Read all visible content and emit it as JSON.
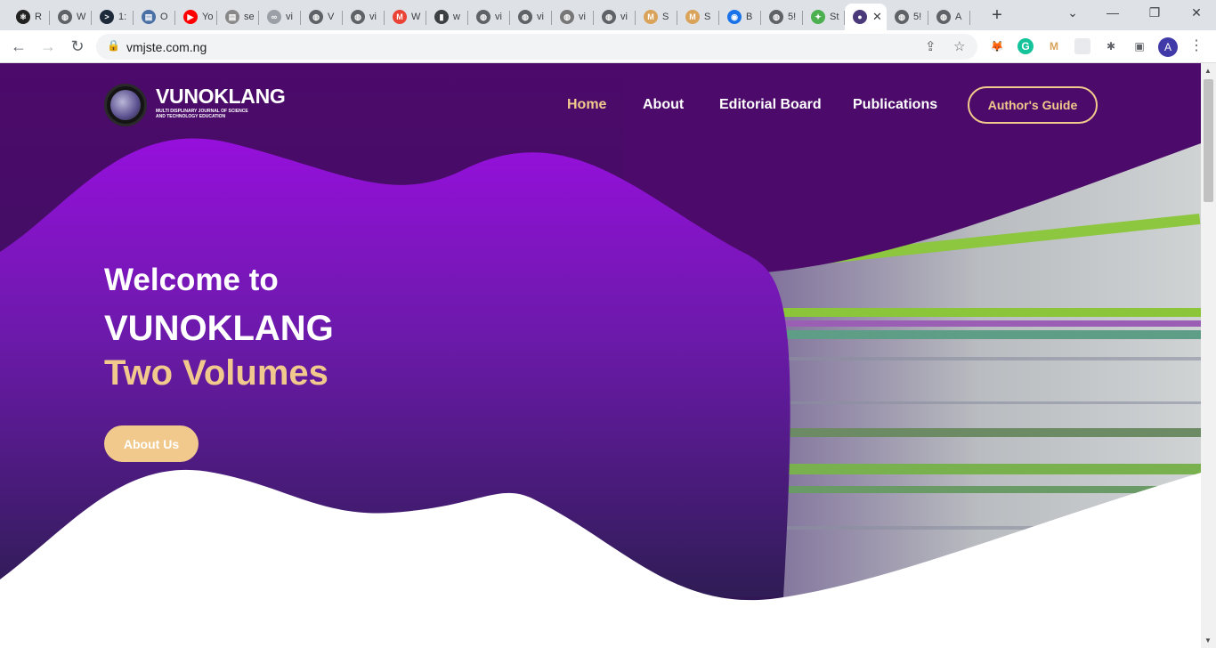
{
  "browser": {
    "tabs": [
      {
        "label": "R",
        "icon": "react-icon",
        "color": "#222"
      },
      {
        "label": "W",
        "icon": "globe-icon",
        "color": "#5f6368"
      },
      {
        "label": "1:",
        "icon": "terminal-icon",
        "color": "#1e2a3a"
      },
      {
        "label": "O",
        "icon": "doc-icon",
        "color": "#4a6fa5"
      },
      {
        "label": "Yo",
        "icon": "youtube-icon",
        "color": "#ff0000"
      },
      {
        "label": "se",
        "icon": "doc-icon",
        "color": "#888"
      },
      {
        "label": "vi",
        "icon": "link-icon",
        "color": "#9aa0a6"
      },
      {
        "label": "V",
        "icon": "globe-icon",
        "color": "#5f6368"
      },
      {
        "label": "vi",
        "icon": "globe-icon",
        "color": "#5f6368"
      },
      {
        "label": "W",
        "icon": "gmail-icon",
        "color": "#ea4335"
      },
      {
        "label": "w",
        "icon": "bookmark-icon",
        "color": "#3c4043"
      },
      {
        "label": "vi",
        "icon": "globe-icon",
        "color": "#5f6368"
      },
      {
        "label": "vi",
        "icon": "globe-icon",
        "color": "#5f6368"
      },
      {
        "label": "vi",
        "icon": "globe-icon",
        "color": "#777"
      },
      {
        "label": "vi",
        "icon": "globe-icon",
        "color": "#5f6368"
      },
      {
        "label": "S",
        "icon": "mail-icon",
        "color": "#d9a35a"
      },
      {
        "label": "S",
        "icon": "mail-icon",
        "color": "#d9a35a"
      },
      {
        "label": "B",
        "icon": "eye-icon",
        "color": "#1a73e8"
      },
      {
        "label": "5!",
        "icon": "globe-icon",
        "color": "#5f6368"
      },
      {
        "label": "St",
        "icon": "puzzle-icon",
        "color": "#4caf50"
      },
      {
        "label": "",
        "icon": "site-logo-icon",
        "color": "#4a3a7a",
        "active": true
      },
      {
        "label": "5!",
        "icon": "globe-icon",
        "color": "#5f6368"
      },
      {
        "label": "A",
        "icon": "globe-icon",
        "color": "#5f6368"
      }
    ],
    "url": "vmjste.com.ng",
    "profile_initial": "A"
  },
  "site": {
    "brand": "VUNOKLANG",
    "brand_sub_1": "MULTI DISPLINARY JOURNAL OF SCIENCE",
    "brand_sub_2": "AND TECHNOLOGY EDUCATION",
    "nav": {
      "home": "Home",
      "about": "About",
      "editorial": "Editorial Board",
      "publications": "Publications",
      "guide": "Author's Guide"
    },
    "hero": {
      "line1": "Welcome to",
      "line2": "VUNOKLANG",
      "line3": "Two Volumes",
      "button": "About Us"
    }
  },
  "colors": {
    "accent": "#f1c98c",
    "purple_dark": "#4a0a66",
    "purple_bright": "#9210d8"
  }
}
